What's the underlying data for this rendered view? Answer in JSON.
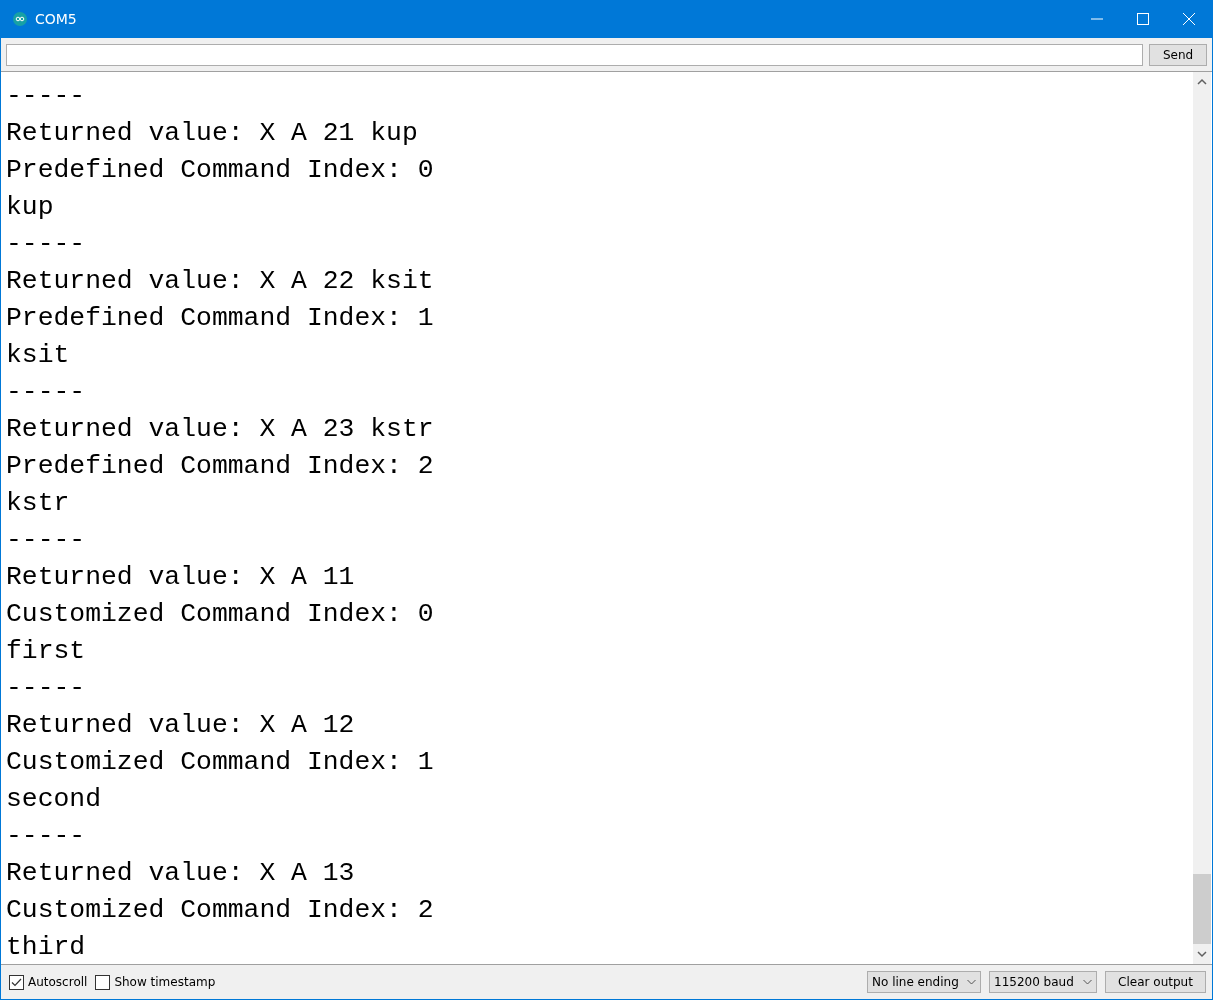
{
  "window": {
    "title": "COM5"
  },
  "send_button": "Send",
  "output_lines": [
    "-----",
    "Returned value: X A 21 kup",
    "Predefined Command Index: 0",
    "kup",
    "-----",
    "Returned value: X A 22 ksit",
    "Predefined Command Index: 1",
    "ksit",
    "-----",
    "Returned value: X A 23 kstr",
    "Predefined Command Index: 2",
    "kstr",
    "-----",
    "Returned value: X A 11",
    "Customized Command Index: 0",
    "first",
    "-----",
    "Returned value: X A 12",
    "Customized Command Index: 1",
    "second",
    "-----",
    "Returned value: X A 13",
    "Customized Command Index: 2",
    "third"
  ],
  "checkboxes": [
    {
      "label": "Autoscroll",
      "checked": true
    },
    {
      "label": "Show timestamp",
      "checked": false
    }
  ],
  "line_ending": "No line ending",
  "baud": "115200 baud",
  "clear_button": "Clear output"
}
